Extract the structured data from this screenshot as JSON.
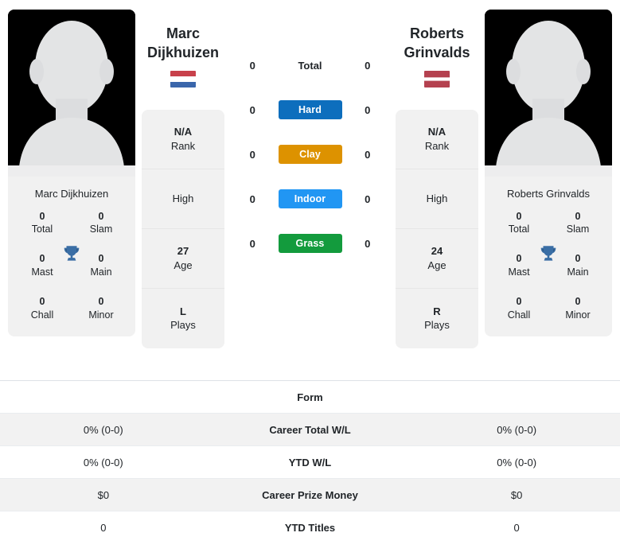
{
  "players": {
    "left": {
      "name_display": "Marc\nDijkhuizen",
      "name_line1": "Marc",
      "name_line2": "Dijkhuizen",
      "photo_caption": "Marc Dijkhuizen",
      "country_flag": "netherlands-flag",
      "info": [
        {
          "value": "N/A",
          "label": "Rank"
        },
        {
          "value": "",
          "label": "High"
        },
        {
          "value": "27",
          "label": "Age"
        },
        {
          "value": "L",
          "label": "Plays"
        }
      ],
      "titles": [
        {
          "value": "0",
          "label": "Total"
        },
        {
          "value": "0",
          "label": "Slam"
        },
        {
          "value": "0",
          "label": "Mast"
        },
        {
          "value": "0",
          "label": "Main"
        },
        {
          "value": "0",
          "label": "Chall"
        },
        {
          "value": "0",
          "label": "Minor"
        }
      ]
    },
    "right": {
      "name_display": "Roberts\nGrinvalds",
      "name_line1": "Roberts",
      "name_line2": "Grinvalds",
      "photo_caption": "Roberts Grinvalds",
      "country_flag": "latvia-flag",
      "info": [
        {
          "value": "N/A",
          "label": "Rank"
        },
        {
          "value": "",
          "label": "High"
        },
        {
          "value": "24",
          "label": "Age"
        },
        {
          "value": "R",
          "label": "Plays"
        }
      ],
      "titles": [
        {
          "value": "0",
          "label": "Total"
        },
        {
          "value": "0",
          "label": "Slam"
        },
        {
          "value": "0",
          "label": "Mast"
        },
        {
          "value": "0",
          "label": "Main"
        },
        {
          "value": "0",
          "label": "Chall"
        },
        {
          "value": "0",
          "label": "Minor"
        }
      ]
    }
  },
  "surfaces": [
    {
      "label": "Total",
      "left": "0",
      "right": "0",
      "style": "plain",
      "color": ""
    },
    {
      "label": "Hard",
      "left": "0",
      "right": "0",
      "style": "badge",
      "color": "#0d6ebd"
    },
    {
      "label": "Clay",
      "left": "0",
      "right": "0",
      "style": "badge",
      "color": "#dd9200"
    },
    {
      "label": "Indoor",
      "left": "0",
      "right": "0",
      "style": "badge",
      "color": "#2196f3"
    },
    {
      "label": "Grass",
      "left": "0",
      "right": "0",
      "style": "badge",
      "color": "#139b3d"
    }
  ],
  "stats_table": {
    "header_label": "Form",
    "rows": [
      {
        "left": "0% (0-0)",
        "label": "Career Total W/L",
        "right": "0% (0-0)"
      },
      {
        "left": "0% (0-0)",
        "label": "YTD W/L",
        "right": "0% (0-0)"
      },
      {
        "left": "$0",
        "label": "Career Prize Money",
        "right": "$0"
      },
      {
        "left": "0",
        "label": "YTD Titles",
        "right": "0"
      }
    ]
  },
  "icons": {
    "trophy": "trophy-icon",
    "avatar": "player-avatar-silhouette"
  },
  "colors": {
    "card_bg": "#f1f1f1",
    "alt_row": "#f2f2f2",
    "text": "#212529",
    "trophy": "#3a6ea5",
    "photo_bg": "#000000"
  }
}
